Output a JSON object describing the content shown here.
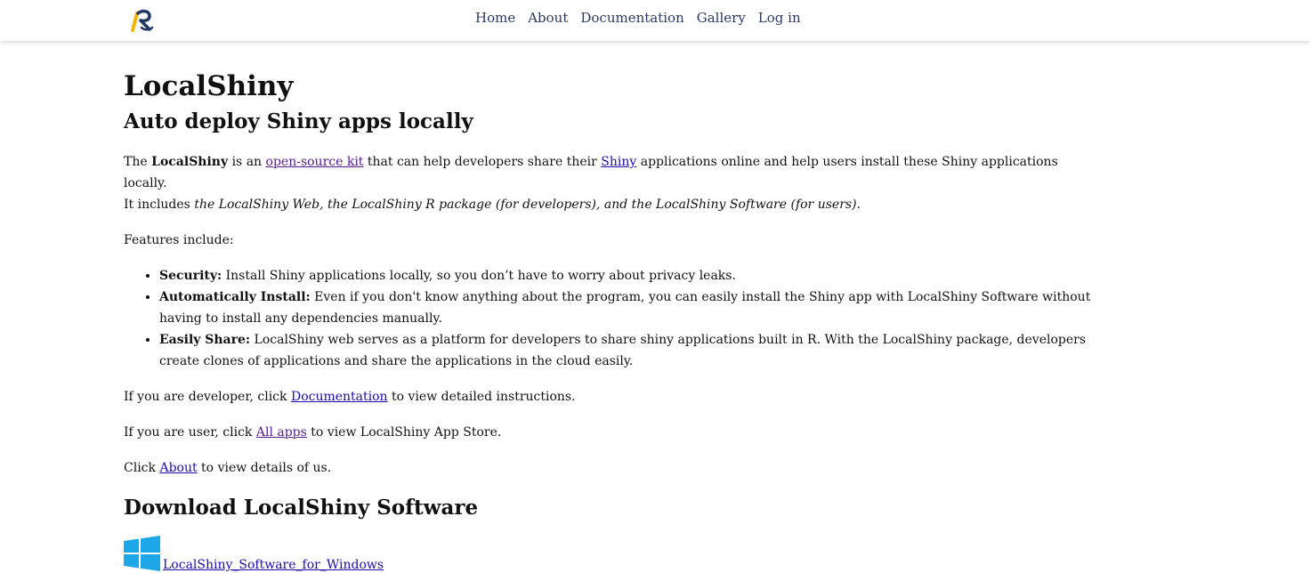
{
  "nav": {
    "items": [
      {
        "label": "Home"
      },
      {
        "label": "About"
      },
      {
        "label": "Documentation"
      },
      {
        "label": "Gallery"
      },
      {
        "label": "Log in"
      }
    ]
  },
  "main": {
    "title": "LocalShiny",
    "subtitle": "Auto deploy Shiny apps locally",
    "intro": {
      "t1": "The ",
      "strong": "LocalShiny",
      "t2": " is an ",
      "link_kit": "open-source kit",
      "t3": " that can help developers share their ",
      "link_shiny": "Shiny",
      "t4": " applications online and help users install these Shiny applications locally.",
      "t5": "It includes ",
      "em": "the LocalShiny Web, the LocalShiny R package (for developers), and the LocalShiny Software (for users)",
      "t6": "."
    },
    "features_label": "Features include:",
    "features": [
      {
        "title": "Security:",
        "text": " Install Shiny applications locally, so you don’t have to worry about privacy leaks."
      },
      {
        "title": "Automatically Install:",
        "text": " Even if you don't know anything about the program, you can easily install the Shiny app with LocalShiny Software without having to install any dependencies manually."
      },
      {
        "title": "Easily Share:",
        "text": " LocalShiny web serves as a platform for developers to share shiny applications built in R. With the LocalShiny package, developers create clones of applications and share the applications in the cloud easily."
      }
    ],
    "dev_line": {
      "pre": "If you are developer, click ",
      "link": "Documentation",
      "post": " to view detailed instructions."
    },
    "user_line": {
      "pre": "If you are user, click ",
      "link": "All apps",
      "post": " to view LocalShiny App Store."
    },
    "about_line": {
      "pre": "Click ",
      "link": "About",
      "post": " to view details of us."
    },
    "download_title": "Download LocalShiny Software",
    "download_link": " LocalShiny_Software_for_Windows"
  },
  "colors": {
    "nav_text": "#2b3a63",
    "link": "#1a0dab",
    "visited_link": "#551a8b",
    "windows_icon": "#1ea7e8",
    "logo_yellow": "#f5b400",
    "logo_navy": "#243a66"
  },
  "icons": {
    "logo": "localshiny-logo",
    "download": "windows-icon"
  }
}
